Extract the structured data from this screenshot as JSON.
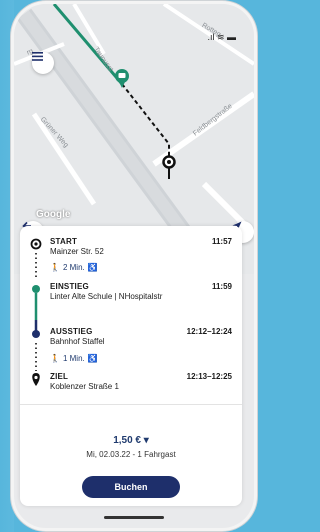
{
  "status": {
    "icons": ".ıl ≋ ▬"
  },
  "map": {
    "labels": [
      "Taunusst",
      "Feldbergstraße",
      "Grüner Weg",
      "Rotteg",
      "rg"
    ],
    "google": "Google"
  },
  "trip": {
    "start": {
      "title": "START",
      "address": "Mainzer Str. 52",
      "time": "11:57"
    },
    "walk1": {
      "text": "2 Min."
    },
    "einstieg": {
      "title": "EINSTIEG",
      "address": "Linter Alte Schule | NHospitalstr",
      "time": "11:59"
    },
    "ausstieg": {
      "title": "AUSSTIEG",
      "address": "Bahnhof Staffel",
      "time": "12:12–12:24"
    },
    "walk2": {
      "text": "1 Min."
    },
    "ziel": {
      "title": "ZIEL",
      "address": "Koblenzer Straße 1",
      "time": "12:13–12:25"
    }
  },
  "booking": {
    "price": "1,50 € ▾",
    "info": "Mi, 02.03.22 - 1 Fahrgast",
    "button": "Buchen"
  },
  "colors": {
    "accent": "#1e2f6b",
    "green": "#1f8f6f",
    "bg": "#57b6dc"
  }
}
